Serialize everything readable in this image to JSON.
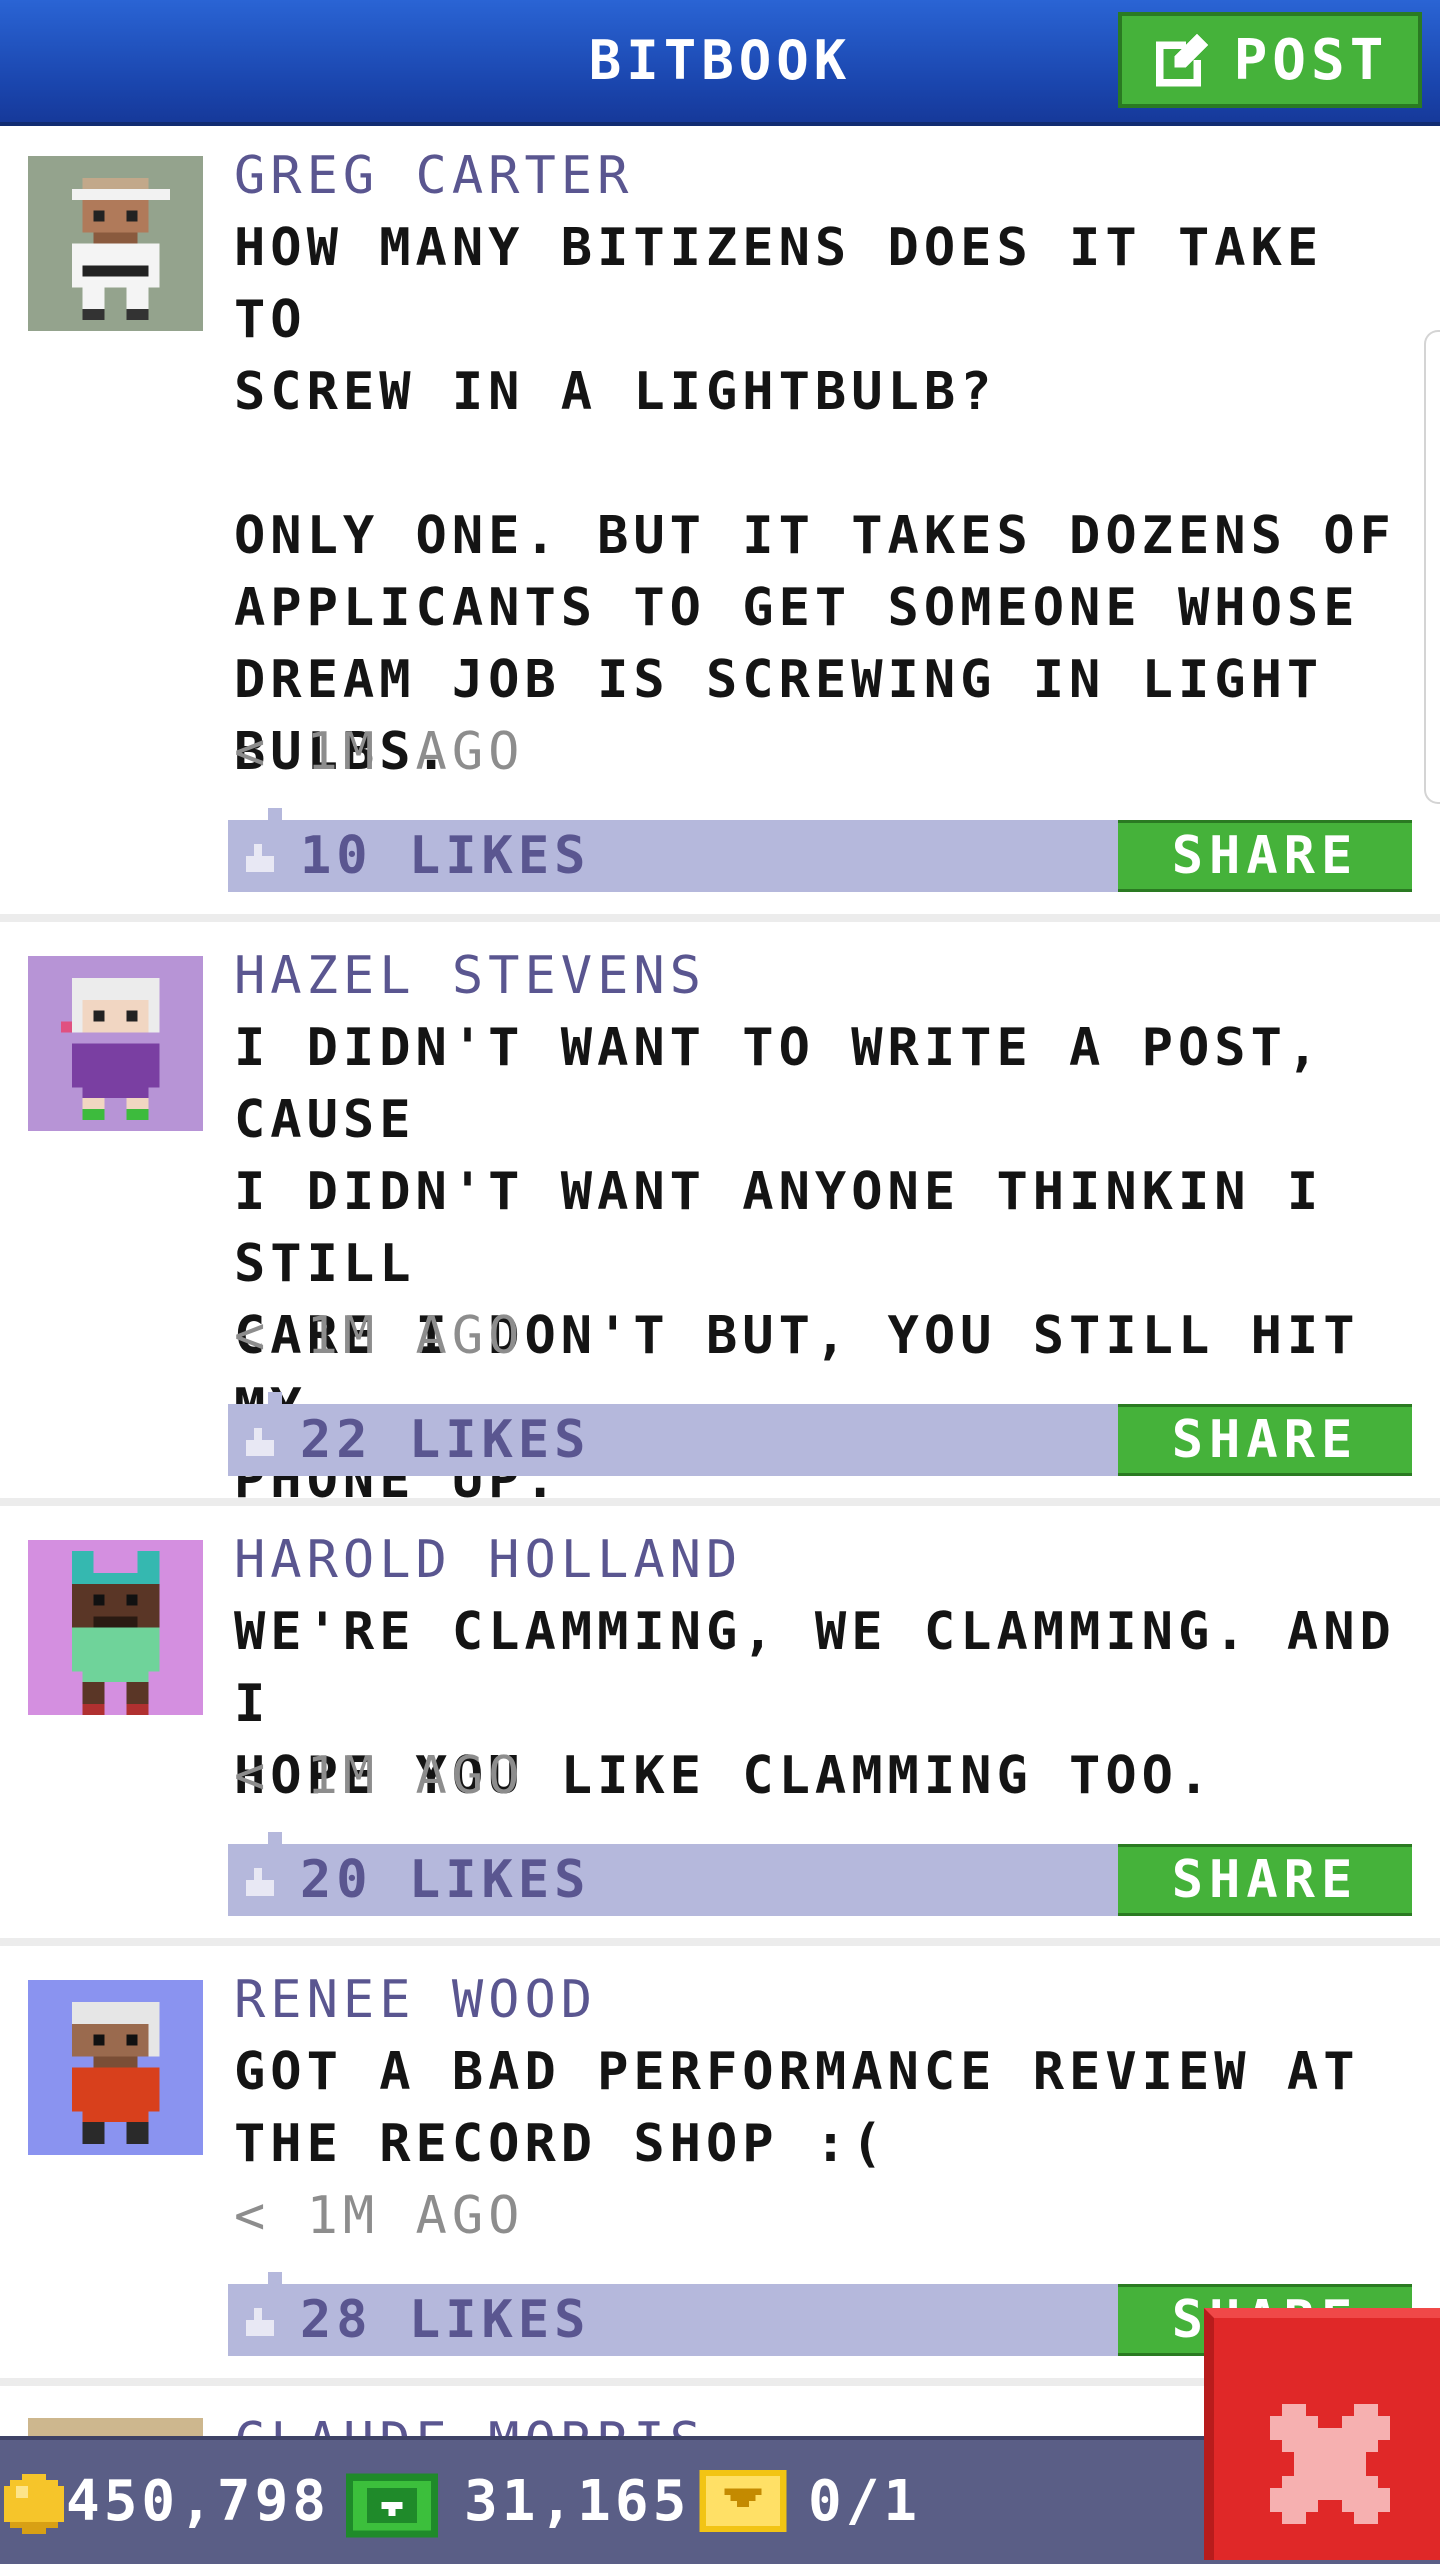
{
  "header": {
    "title": "BITBOOK",
    "post_label": "POST",
    "post_icon": "edit-icon",
    "bg_color": "#1e4fbd",
    "button_color": "#45b23a"
  },
  "posts": [
    {
      "author": "GREG CARTER",
      "text": "HOW MANY BITIZENS DOES IT TAKE TO\nSCREW IN A LIGHTBULB?\n\nONLY ONE. BUT IT TAKES DOZENS OF\nAPPLICANTS TO GET SOMEONE WHOSE\nDREAM JOB IS SCREWING IN LIGHT\nBULBS.",
      "time": "< 1M AGO",
      "likes": "10 LIKES",
      "share": "SHARE",
      "avatar_bg": "#94a38d"
    },
    {
      "author": "HAZEL STEVENS",
      "text": "I DIDN'T WANT TO WRITE A POST, CAUSE\nI DIDN'T WANT ANYONE THINKIN I STILL\nCARE I DON'T BUT, YOU STILL HIT MY\nPHONE UP.",
      "time": "< 1M AGO",
      "likes": "22 LIKES",
      "share": "SHARE",
      "avatar_bg": "#b794d6"
    },
    {
      "author": "HAROLD HOLLAND",
      "text": "WE'RE CLAMMING, WE CLAMMING. AND I\nHOPE YOU LIKE CLAMMING TOO.",
      "time": "< 1M AGO",
      "likes": "20 LIKES",
      "share": "SHARE",
      "avatar_bg": "#d48fe0"
    },
    {
      "author": "RENEE WOOD",
      "text": "GOT A BAD PERFORMANCE REVIEW AT\nTHE RECORD SHOP :(",
      "time": "< 1M AGO",
      "likes": "28 LIKES",
      "share": "SHARE",
      "avatar_bg": "#8a93f0"
    }
  ],
  "partial_post": {
    "author": "CLAUDE MORRIS"
  },
  "bottom_bar": {
    "coins": "450,798",
    "bux": "31,165",
    "tickets": "0/1",
    "coin_icon": "coin-icon",
    "bux_icon": "bux-icon",
    "ticket_icon": "ticket-icon"
  },
  "close_button": {
    "icon": "close-icon",
    "color": "#e02828"
  }
}
